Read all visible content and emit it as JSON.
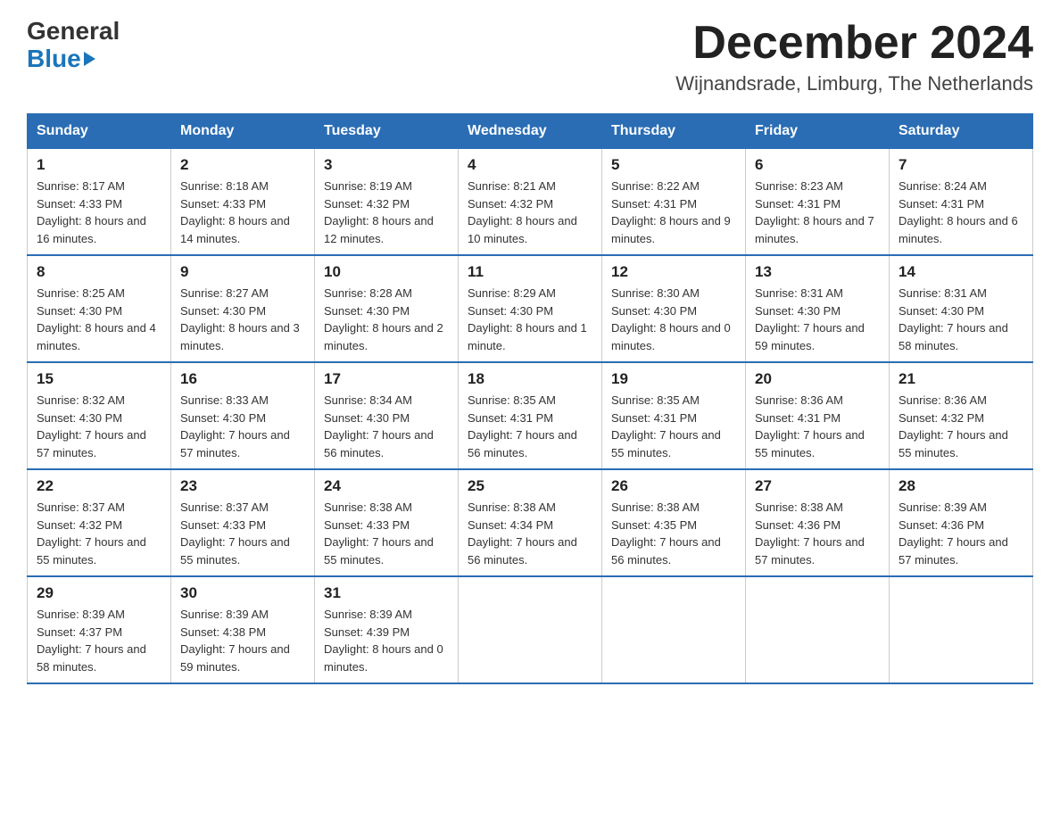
{
  "header": {
    "logo_general": "General",
    "logo_blue": "Blue",
    "month_title": "December 2024",
    "location": "Wijnandsrade, Limburg, The Netherlands"
  },
  "days_of_week": [
    "Sunday",
    "Monday",
    "Tuesday",
    "Wednesday",
    "Thursday",
    "Friday",
    "Saturday"
  ],
  "weeks": [
    [
      {
        "day": "1",
        "sunrise": "8:17 AM",
        "sunset": "4:33 PM",
        "daylight": "8 hours and 16 minutes."
      },
      {
        "day": "2",
        "sunrise": "8:18 AM",
        "sunset": "4:33 PM",
        "daylight": "8 hours and 14 minutes."
      },
      {
        "day": "3",
        "sunrise": "8:19 AM",
        "sunset": "4:32 PM",
        "daylight": "8 hours and 12 minutes."
      },
      {
        "day": "4",
        "sunrise": "8:21 AM",
        "sunset": "4:32 PM",
        "daylight": "8 hours and 10 minutes."
      },
      {
        "day": "5",
        "sunrise": "8:22 AM",
        "sunset": "4:31 PM",
        "daylight": "8 hours and 9 minutes."
      },
      {
        "day": "6",
        "sunrise": "8:23 AM",
        "sunset": "4:31 PM",
        "daylight": "8 hours and 7 minutes."
      },
      {
        "day": "7",
        "sunrise": "8:24 AM",
        "sunset": "4:31 PM",
        "daylight": "8 hours and 6 minutes."
      }
    ],
    [
      {
        "day": "8",
        "sunrise": "8:25 AM",
        "sunset": "4:30 PM",
        "daylight": "8 hours and 4 minutes."
      },
      {
        "day": "9",
        "sunrise": "8:27 AM",
        "sunset": "4:30 PM",
        "daylight": "8 hours and 3 minutes."
      },
      {
        "day": "10",
        "sunrise": "8:28 AM",
        "sunset": "4:30 PM",
        "daylight": "8 hours and 2 minutes."
      },
      {
        "day": "11",
        "sunrise": "8:29 AM",
        "sunset": "4:30 PM",
        "daylight": "8 hours and 1 minute."
      },
      {
        "day": "12",
        "sunrise": "8:30 AM",
        "sunset": "4:30 PM",
        "daylight": "8 hours and 0 minutes."
      },
      {
        "day": "13",
        "sunrise": "8:31 AM",
        "sunset": "4:30 PM",
        "daylight": "7 hours and 59 minutes."
      },
      {
        "day": "14",
        "sunrise": "8:31 AM",
        "sunset": "4:30 PM",
        "daylight": "7 hours and 58 minutes."
      }
    ],
    [
      {
        "day": "15",
        "sunrise": "8:32 AM",
        "sunset": "4:30 PM",
        "daylight": "7 hours and 57 minutes."
      },
      {
        "day": "16",
        "sunrise": "8:33 AM",
        "sunset": "4:30 PM",
        "daylight": "7 hours and 57 minutes."
      },
      {
        "day": "17",
        "sunrise": "8:34 AM",
        "sunset": "4:30 PM",
        "daylight": "7 hours and 56 minutes."
      },
      {
        "day": "18",
        "sunrise": "8:35 AM",
        "sunset": "4:31 PM",
        "daylight": "7 hours and 56 minutes."
      },
      {
        "day": "19",
        "sunrise": "8:35 AM",
        "sunset": "4:31 PM",
        "daylight": "7 hours and 55 minutes."
      },
      {
        "day": "20",
        "sunrise": "8:36 AM",
        "sunset": "4:31 PM",
        "daylight": "7 hours and 55 minutes."
      },
      {
        "day": "21",
        "sunrise": "8:36 AM",
        "sunset": "4:32 PM",
        "daylight": "7 hours and 55 minutes."
      }
    ],
    [
      {
        "day": "22",
        "sunrise": "8:37 AM",
        "sunset": "4:32 PM",
        "daylight": "7 hours and 55 minutes."
      },
      {
        "day": "23",
        "sunrise": "8:37 AM",
        "sunset": "4:33 PM",
        "daylight": "7 hours and 55 minutes."
      },
      {
        "day": "24",
        "sunrise": "8:38 AM",
        "sunset": "4:33 PM",
        "daylight": "7 hours and 55 minutes."
      },
      {
        "day": "25",
        "sunrise": "8:38 AM",
        "sunset": "4:34 PM",
        "daylight": "7 hours and 56 minutes."
      },
      {
        "day": "26",
        "sunrise": "8:38 AM",
        "sunset": "4:35 PM",
        "daylight": "7 hours and 56 minutes."
      },
      {
        "day": "27",
        "sunrise": "8:38 AM",
        "sunset": "4:36 PM",
        "daylight": "7 hours and 57 minutes."
      },
      {
        "day": "28",
        "sunrise": "8:39 AM",
        "sunset": "4:36 PM",
        "daylight": "7 hours and 57 minutes."
      }
    ],
    [
      {
        "day": "29",
        "sunrise": "8:39 AM",
        "sunset": "4:37 PM",
        "daylight": "7 hours and 58 minutes."
      },
      {
        "day": "30",
        "sunrise": "8:39 AM",
        "sunset": "4:38 PM",
        "daylight": "7 hours and 59 minutes."
      },
      {
        "day": "31",
        "sunrise": "8:39 AM",
        "sunset": "4:39 PM",
        "daylight": "8 hours and 0 minutes."
      },
      null,
      null,
      null,
      null
    ]
  ],
  "labels": {
    "sunrise": "Sunrise:",
    "sunset": "Sunset:",
    "daylight": "Daylight:"
  }
}
